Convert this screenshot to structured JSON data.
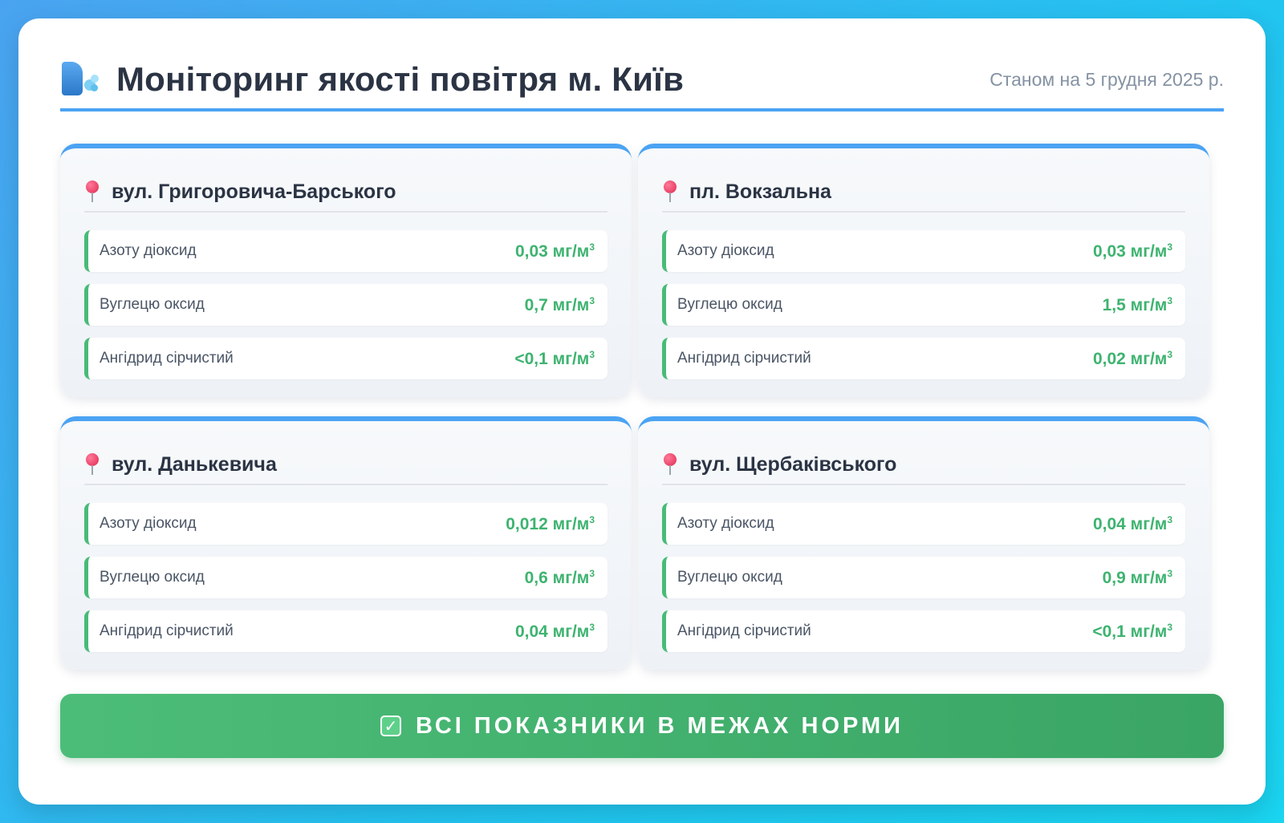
{
  "header": {
    "title": "Моніторинг якості повітря м. Київ",
    "date": "Станом на 5 грудня 2025 р.",
    "logo_icon": "air-breath-icon"
  },
  "unit": "мг/м",
  "unit_exp": "3",
  "stations": [
    {
      "name": "вул. Григоровича-Барського",
      "readings": [
        {
          "label": "Азоту діоксид",
          "value": "0,03"
        },
        {
          "label": "Вуглецю оксид",
          "value": "0,7"
        },
        {
          "label": "Ангідрид сірчистий",
          "value": "<0,1"
        }
      ]
    },
    {
      "name": "пл. Вокзальна",
      "readings": [
        {
          "label": "Азоту діоксид",
          "value": "0,03"
        },
        {
          "label": "Вуглецю оксид",
          "value": "1,5"
        },
        {
          "label": "Ангідрид сірчистий",
          "value": "0,02"
        }
      ]
    },
    {
      "name": "вул. Данькевича",
      "readings": [
        {
          "label": "Азоту діоксид",
          "value": "0,012"
        },
        {
          "label": "Вуглецю оксид",
          "value": "0,6"
        },
        {
          "label": "Ангідрид сірчистий",
          "value": "0,04"
        }
      ]
    },
    {
      "name": "вул. Щербаківського",
      "readings": [
        {
          "label": "Азоту діоксид",
          "value": "0,04"
        },
        {
          "label": "Вуглецю оксид",
          "value": "0,9"
        },
        {
          "label": "Ангідрид сірчистий",
          "value": "<0,1"
        }
      ]
    }
  ],
  "status": {
    "text": "ВСІ ПОКАЗНИКИ В МЕЖАХ НОРМИ",
    "icon": "check-icon",
    "color": "#48bb78"
  },
  "colors": {
    "accent": "#4ba3f3",
    "ok": "#3eb370",
    "pin": "#e0294f"
  }
}
